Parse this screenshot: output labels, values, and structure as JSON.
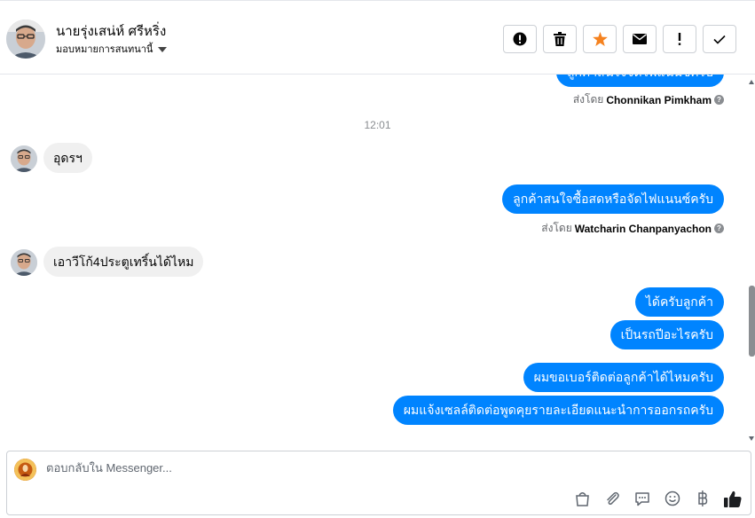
{
  "header": {
    "contact_name": "นายรุ่งเสน่ห์ ศรีหริ่ง",
    "assign_label": "มอบหมายการสนทนานี้"
  },
  "actions": [
    {
      "name": "report-spam-button",
      "icon": "alert-circle-icon",
      "color": "#050505"
    },
    {
      "name": "delete-button",
      "icon": "trash-icon",
      "color": "#050505"
    },
    {
      "name": "star-button",
      "icon": "star-icon",
      "color": "#f5821f"
    },
    {
      "name": "mark-unread-button",
      "icon": "envelope-icon",
      "color": "#050505"
    },
    {
      "name": "follow-up-button",
      "icon": "exclamation-icon",
      "color": "#050505"
    },
    {
      "name": "mark-done-button",
      "icon": "check-icon",
      "color": "#050505"
    }
  ],
  "messages": {
    "partial_top_text": "ลูกค้าสนใจจัดไฟแนนซ์ครับ",
    "sent_by_1": {
      "prefix": "ส่งโดย",
      "agent": "Chonnikan Pimkham"
    },
    "time_divider": "12:01",
    "in_1": "อุดรฯ",
    "out_1": "ลูกค้าสนใจซื้อสดหรือจัดไฟแนนซ์ครับ",
    "sent_by_2": {
      "prefix": "ส่งโดย",
      "agent": "Watcharin Chanpanyachon"
    },
    "in_2": "เอาวีโก้4ประตูเทริ์นได้ไหม",
    "out_2": "ได้ครับลูกค้า",
    "out_3": "เป็นรถปีอะไรครับ",
    "out_4": "ผมขอเบอร์ติดต่อลูกค้าได้ไหมครับ",
    "out_5": "ผมแจ้งเซลล์ติดต่อพูดคุยรายละเอียดแนะนำการออกรถครับ"
  },
  "composer": {
    "placeholder": "ตอบกลับใน Messenger..."
  },
  "colors": {
    "accent": "#0084ff",
    "incoming_bubble": "#f0f0f0",
    "star": "#f5821f"
  }
}
